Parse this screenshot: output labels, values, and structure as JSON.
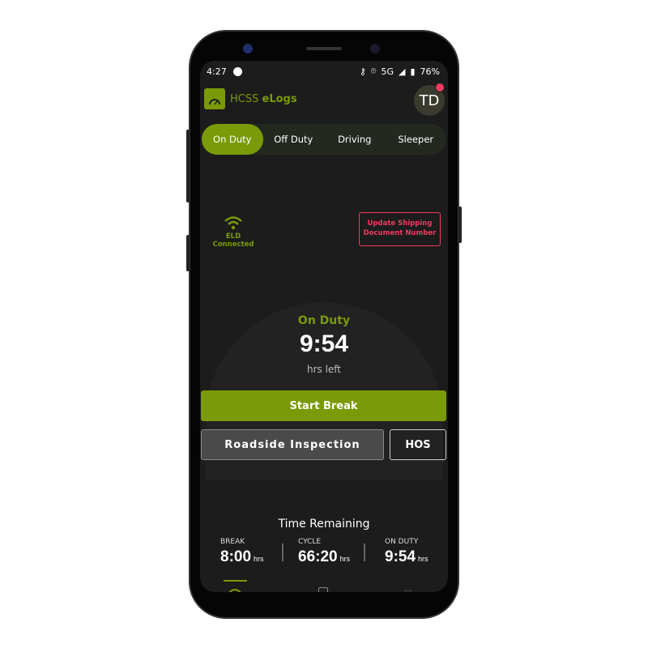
{
  "status_bar": {
    "time": "4:27",
    "network": "5G",
    "battery": "76%"
  },
  "header": {
    "app_name_prefix": "HCSS",
    "app_name_suffix": "eLogs",
    "avatar_initials": "TD"
  },
  "duty_tabs": [
    {
      "label": "On Duty",
      "active": true
    },
    {
      "label": "Off Duty"
    },
    {
      "label": "Driving"
    },
    {
      "label": "Sleeper"
    }
  ],
  "eld_status": "ELD Connected",
  "alert_button": "Update Shipping Document Number",
  "current_status": {
    "label": "On Duty",
    "time": "9:54",
    "sub": "hrs left"
  },
  "actions": {
    "start_break": "Start Break",
    "roadside": "Roadside Inspection",
    "hos": "HOS"
  },
  "time_remaining": {
    "title": "Time Remaining",
    "unit": "hrs",
    "items": [
      {
        "label": "BREAK",
        "value": "8:00"
      },
      {
        "label": "CYCLE",
        "value": "66:20"
      },
      {
        "label": "ON DUTY",
        "value": "9:54"
      }
    ]
  },
  "colors": {
    "accent": "#7a9a08",
    "alert": "#f03a5f",
    "background": "#1c1c1c"
  }
}
